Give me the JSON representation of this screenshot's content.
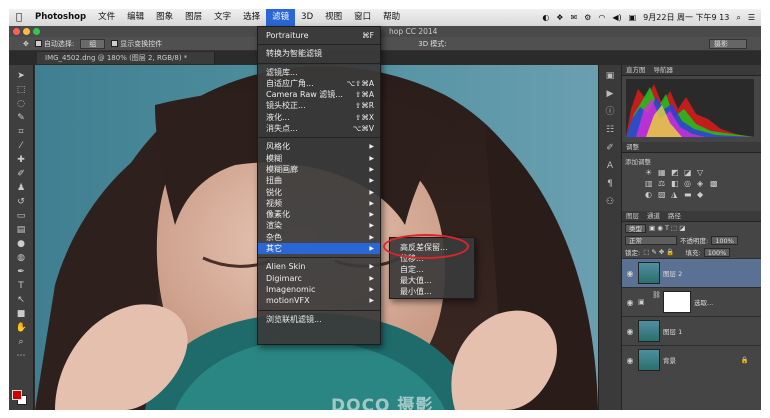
{
  "menubar": {
    "app_name": "Photoshop",
    "items": [
      "文件",
      "编辑",
      "图象",
      "图层",
      "文字",
      "选择",
      "滤镜",
      "3D",
      "视图",
      "窗口",
      "帮助"
    ],
    "active_item": "滤镜",
    "clock": "9月22日 周一 下午9 13",
    "highlight_color": "#2b67d4"
  },
  "window": {
    "title": "hop CC 2014"
  },
  "options_bar": {
    "auto_select_label": "自动选择:",
    "auto_select_value": "组",
    "transform_controls_label": "显示变换控件",
    "mode_label": "3D 模式:",
    "workspace_value": "摄影"
  },
  "document": {
    "tab_title": "IMG_4502.dng @ 180% (图层 2, RGB/8) *"
  },
  "filter_menu": {
    "items": [
      {
        "label": "Portraiture",
        "shortcut": "⌘F"
      },
      {
        "label": "转换为智能滤镜"
      },
      {
        "label": "滤镜库..."
      },
      {
        "label": "自适应广角...",
        "shortcut": "⌥⇧⌘A"
      },
      {
        "label": "Camera Raw 滤镜...",
        "shortcut": "⇧⌘A"
      },
      {
        "label": "镜头校正...",
        "shortcut": "⇧⌘R"
      },
      {
        "label": "液化...",
        "shortcut": "⇧⌘X"
      },
      {
        "label": "消失点...",
        "shortcut": "⌥⌘V"
      },
      {
        "label": "风格化"
      },
      {
        "label": "模糊"
      },
      {
        "label": "模糊画廊"
      },
      {
        "label": "扭曲"
      },
      {
        "label": "锐化"
      },
      {
        "label": "视频"
      },
      {
        "label": "像素化"
      },
      {
        "label": "渲染"
      },
      {
        "label": "杂色"
      },
      {
        "label": "其它",
        "highlighted": true
      },
      {
        "label": "Alien Skin"
      },
      {
        "label": "Digimarc"
      },
      {
        "label": "Imagenomic"
      },
      {
        "label": "motionVFX"
      },
      {
        "label": "浏览联机滤镜..."
      }
    ]
  },
  "other_submenu": {
    "items": [
      "高反差保留...",
      "位移...",
      "自定...",
      "最大值...",
      "最小值..."
    ],
    "circled_item": "高反差保留...",
    "circle_color": "#e0242a"
  },
  "panels": {
    "histogram_tabs": [
      "直方图",
      "导航器"
    ],
    "adjust_tab": "调整",
    "adjust_add_label": "添加调整",
    "layers_tabs": [
      "图层",
      "通道",
      "路径"
    ],
    "kind_select": "类型",
    "blend_mode": "正常",
    "opacity_label": "不透明度:",
    "opacity_value": "100%",
    "lock_label": "锁定:",
    "fill_label": "填充:",
    "fill_value": "100%",
    "layers": [
      {
        "name": "图层 2",
        "selected": true
      },
      {
        "name": "选取...",
        "mask": true
      },
      {
        "name": "图层 1"
      },
      {
        "name": "背景",
        "locked": true
      }
    ],
    "selected_layer_color": "#5b7193"
  },
  "watermark": "DOCO 摄影"
}
